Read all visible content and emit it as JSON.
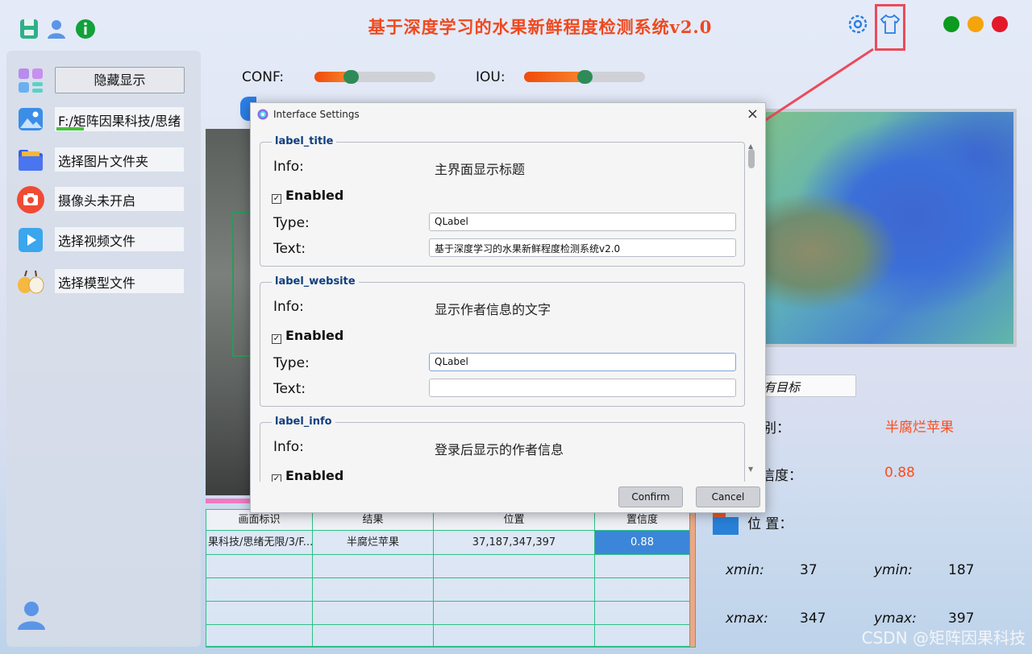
{
  "app": {
    "title": "基于深度学习的水果新鲜程度检测系统v2.0",
    "colors": {
      "title": "#f0481e",
      "close": "#e3192a",
      "minimize": "#f5a40a",
      "maximize": "#0c9b1e",
      "accent_orange": "#ff4a1a"
    },
    "watermark": "CSDN @矩阵因果科技"
  },
  "sidebar": {
    "hide_button": "隐藏显示",
    "items": [
      {
        "label": "F:/矩阵因果科技/思绪",
        "icon": "image-icon"
      },
      {
        "label": "选择图片文件夹",
        "icon": "folder-icon"
      },
      {
        "label": "摄像头未开启",
        "icon": "camera-icon"
      },
      {
        "label": "选择视频文件",
        "icon": "video-icon"
      },
      {
        "label": "选择模型文件",
        "icon": "fruit-icon"
      }
    ]
  },
  "sliders": {
    "conf": {
      "label": "CONF:",
      "value": 0.3
    },
    "iou": {
      "label": "IOU:",
      "value": 0.5
    }
  },
  "result_panel": {
    "target_select": "有目标",
    "class_label": "别：",
    "class_value": "半腐烂苹果",
    "conf_label": "信度：",
    "conf_value": "0.88",
    "pos_label": "位 置：",
    "xmin_label": "xmin:",
    "xmin": "37",
    "ymin_label": "ymin:",
    "ymin": "187",
    "xmax_label": "xmax:",
    "xmax": "347",
    "ymax_label": "ymax:",
    "ymax": "397"
  },
  "table": {
    "headers": [
      "画面标识",
      "结果",
      "位置",
      "置信度"
    ],
    "rows": [
      [
        "果科技/思绪无限/3/F...",
        "半腐烂苹果",
        "37,187,347,397",
        "0.88"
      ]
    ]
  },
  "dialog": {
    "title": "Interface Settings",
    "close": "×",
    "groups": [
      {
        "name": "label_title",
        "info_label": "Info:",
        "info": "主界面显示标题",
        "enabled_label": "Enabled",
        "type_label": "Type:",
        "type": "QLabel",
        "text_label": "Text:",
        "text": "基于深度学习的水果新鲜程度检测系统v2.0"
      },
      {
        "name": "label_website",
        "info_label": "Info:",
        "info": "显示作者信息的文字",
        "enabled_label": "Enabled",
        "type_label": "Type:",
        "type": "QLabel",
        "text_label": "Text:",
        "text": ""
      },
      {
        "name": "label_info",
        "info_label": "Info:",
        "info": "登录后显示的作者信息",
        "enabled_label": "Enabled"
      }
    ],
    "confirm": "Confirm",
    "cancel": "Cancel"
  }
}
